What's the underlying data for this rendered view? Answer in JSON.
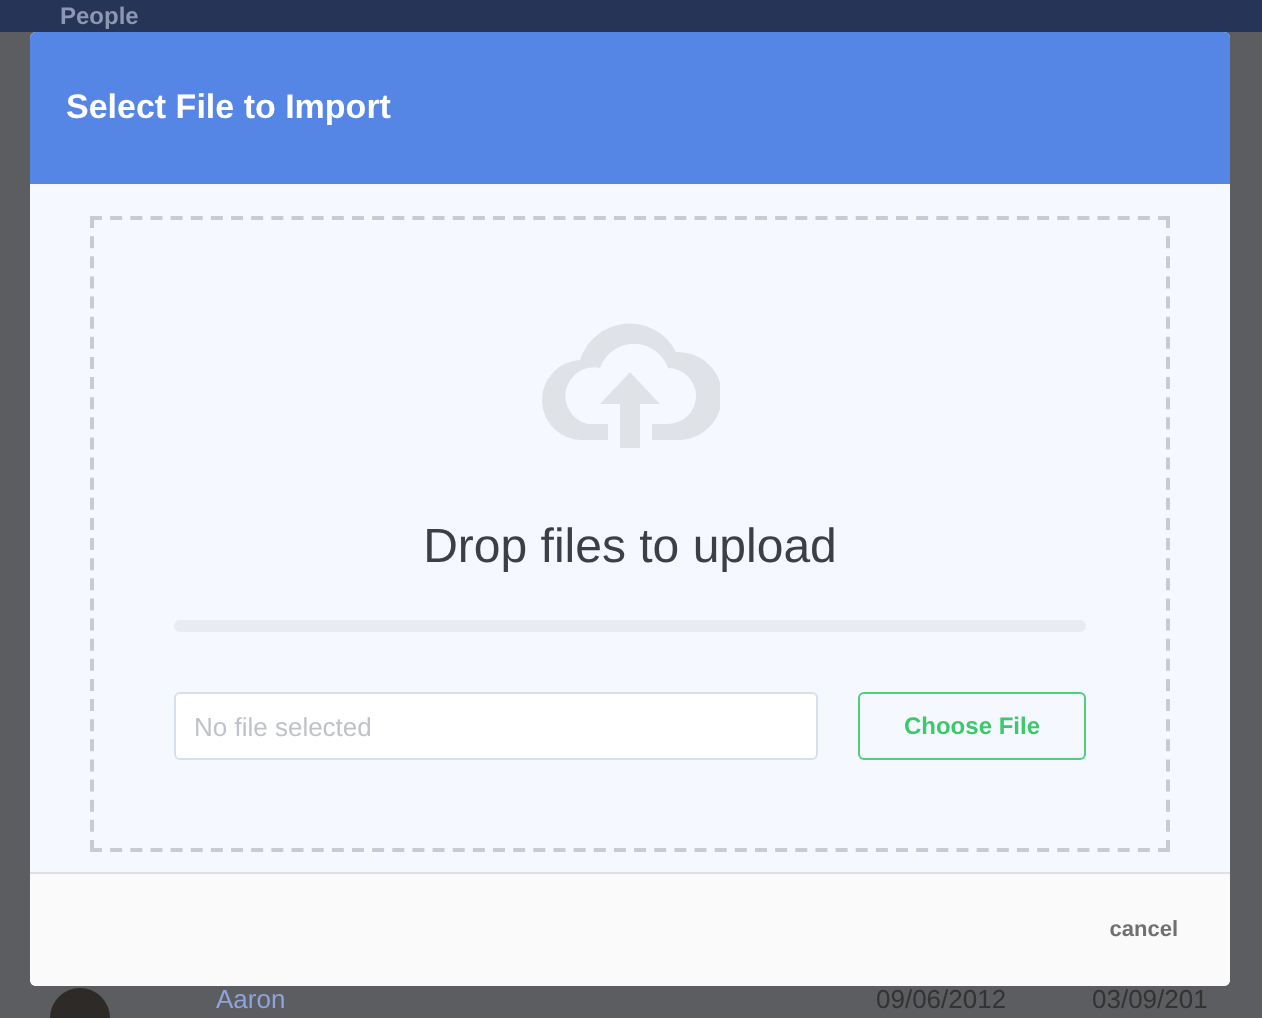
{
  "app": {
    "title": "People"
  },
  "background_row": {
    "name": "Aaron",
    "column_2": "09/06/2012",
    "column_3": "03/09/201"
  },
  "dialog": {
    "title": "Select File to Import",
    "drop_zone": {
      "prompt": "Drop files to upload",
      "progress": {
        "level": 0
      }
    },
    "file_field": {
      "placeholder": "No file selected"
    },
    "choose_button": "Choose File",
    "cancel_button": "cancel"
  }
}
